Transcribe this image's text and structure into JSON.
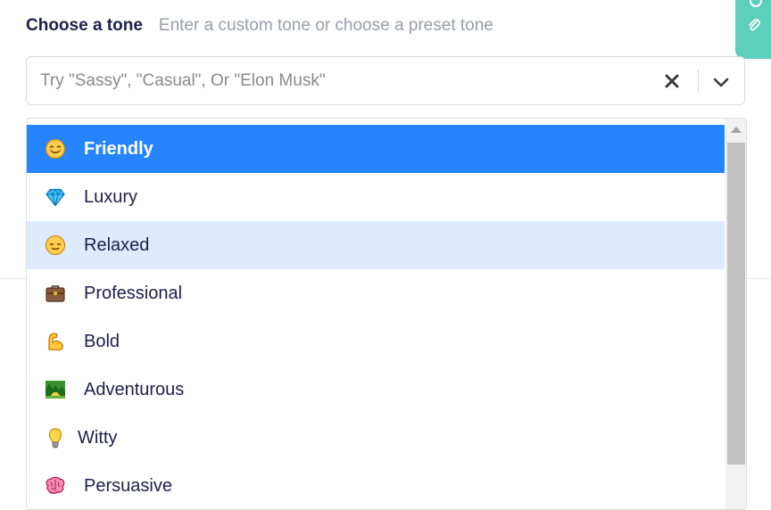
{
  "header": {
    "label": "Choose a tone",
    "sublabel": "Enter a custom tone or choose a preset tone"
  },
  "combo": {
    "placeholder": "Try \"Sassy\", \"Casual\", Or \"Elon Musk\"",
    "clear_icon": "close-icon",
    "toggle_icon": "chevron-down-icon"
  },
  "menu": {
    "options": [
      {
        "label": "Friendly",
        "icon": "smiling-face-icon",
        "state": "selected"
      },
      {
        "label": "Luxury",
        "icon": "gem-icon",
        "state": "normal"
      },
      {
        "label": "Relaxed",
        "icon": "relieved-face-icon",
        "state": "focused"
      },
      {
        "label": "Professional",
        "icon": "briefcase-icon",
        "state": "normal"
      },
      {
        "label": "Bold",
        "icon": "flexed-biceps-icon",
        "state": "normal"
      },
      {
        "label": "Adventurous",
        "icon": "national-park-icon",
        "state": "normal"
      },
      {
        "label": "Witty",
        "icon": "lightbulb-icon",
        "state": "normal"
      },
      {
        "label": "Persuasive",
        "icon": "brain-icon",
        "state": "normal"
      }
    ]
  },
  "colors": {
    "selected": "#2684ff",
    "focused": "#deebff",
    "accent_tab": "#5ccfbd",
    "label_text": "#1c1f4a"
  }
}
